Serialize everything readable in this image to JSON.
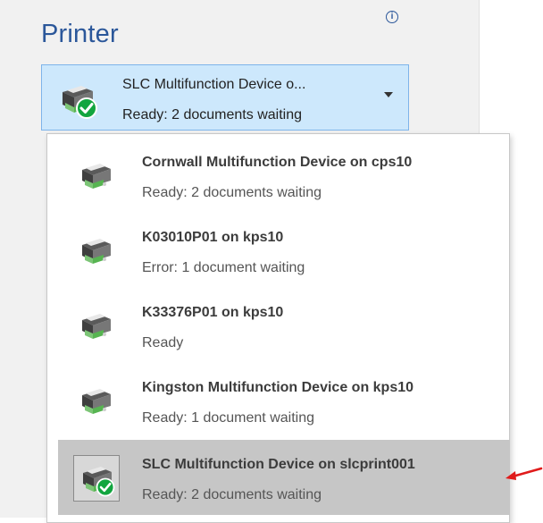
{
  "header": {
    "title": "Printer",
    "info_icon_glyph": "i"
  },
  "selector": {
    "name": "SLC Multifunction Device o...",
    "status": "Ready: 2 documents waiting",
    "icon": "printer-ready-icon"
  },
  "printers": [
    {
      "name": "Cornwall Multifunction Device on cps10",
      "status": "Ready: 2 documents waiting",
      "icon": "printer-icon",
      "selected": false
    },
    {
      "name": "K03010P01 on kps10",
      "status": "Error: 1 document waiting",
      "icon": "printer-icon",
      "selected": false
    },
    {
      "name": "K33376P01 on kps10",
      "status": "Ready",
      "icon": "printer-icon",
      "selected": false
    },
    {
      "name": "Kingston Multifunction Device on kps10",
      "status": "Ready: 1 document waiting",
      "icon": "printer-icon",
      "selected": false
    },
    {
      "name": "SLC Multifunction Device on slcprint001",
      "status": "Ready: 2 documents waiting",
      "icon": "printer-ready-icon",
      "selected": true
    }
  ],
  "colors": {
    "accent": "#2b579a",
    "selector_bg": "#cde8fc",
    "selector_border": "#7eb4ea",
    "selected_item_bg": "#c6c6c6",
    "check_green": "#12a53f",
    "annotation_arrow": "#e01b1b"
  }
}
